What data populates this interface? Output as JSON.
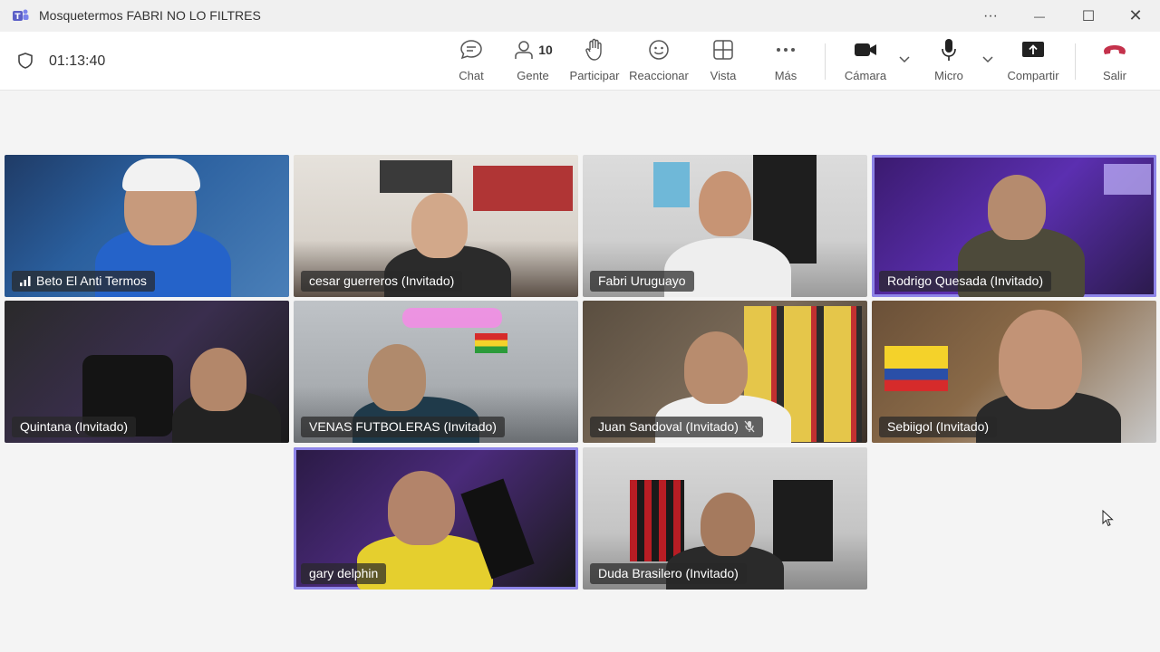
{
  "window": {
    "title": "Mosquetermos FABRI NO LO FILTRES",
    "more_glyph": "···",
    "minimize_glyph": "—",
    "maximize_glyph": "☐",
    "close_glyph": "✕"
  },
  "meeting": {
    "elapsed_time": "01:13:40"
  },
  "toolbar": {
    "chat_label": "Chat",
    "people_label": "Gente",
    "people_count": "10",
    "raise_hand_label": "Participar",
    "react_label": "Reaccionar",
    "view_label": "Vista",
    "more_label": "Más",
    "camera_label": "Cámara",
    "mic_label": "Micro",
    "share_label": "Compartir",
    "leave_label": "Salir"
  },
  "participants": [
    {
      "name": "Beto El Anti Termos",
      "speaking_indicator": true,
      "muted": false,
      "active": false
    },
    {
      "name": "cesar guerreros (Invitado)",
      "muted": false,
      "active": false
    },
    {
      "name": "Fabri Uruguayo",
      "muted": false,
      "active": false
    },
    {
      "name": "Rodrigo Quesada (Invitado)",
      "muted": false,
      "active": true
    },
    {
      "name": "Quintana (Invitado)",
      "muted": false,
      "active": false
    },
    {
      "name": "VENAS FUTBOLERAS (Invitado)",
      "muted": false,
      "active": false
    },
    {
      "name": "Juan Sandoval (Invitado)",
      "muted": true,
      "active": false
    },
    {
      "name": "Sebiigol (Invitado)",
      "muted": false,
      "active": false
    },
    {
      "name": "gary delphin",
      "muted": false,
      "active": true
    },
    {
      "name": "Duda Brasilero (Invitado)",
      "muted": false,
      "active": false
    }
  ],
  "colors": {
    "accent": "#8e85e8",
    "leave_red": "#c4314b",
    "toolbar_bg": "#ffffff",
    "stage_bg": "#f4f4f4"
  }
}
